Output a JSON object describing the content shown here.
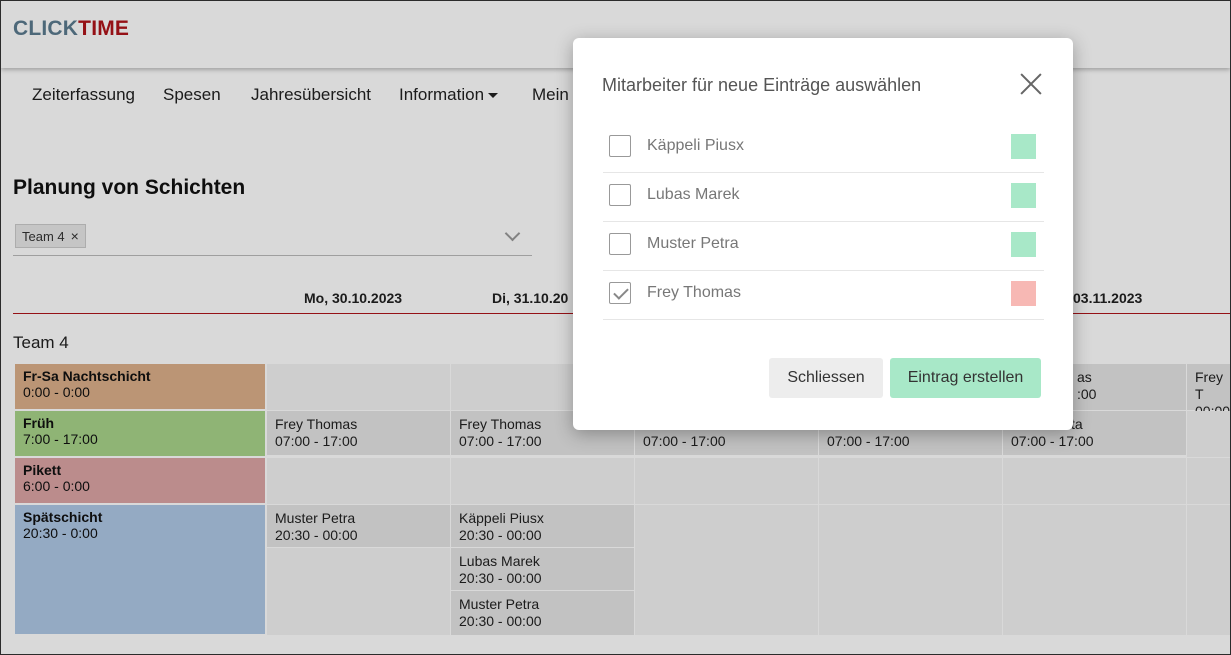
{
  "logo": {
    "part1": "CLICK",
    "part2": "TIME"
  },
  "nav": [
    {
      "label": "Zeiterfassung"
    },
    {
      "label": "Spesen"
    },
    {
      "label": "Jahresübersicht"
    },
    {
      "label": "Information"
    },
    {
      "label": "Mein T"
    }
  ],
  "page_title": "Planung von Schichten",
  "filter": {
    "chip": "Team 4",
    "chip_remove": "×"
  },
  "days": [
    "Mo, 30.10.2023",
    "Di, 31.10.20",
    "03.11.2023"
  ],
  "team_label": "Team 4",
  "shifts": [
    {
      "name": "Fr-Sa Nachtschicht",
      "time": "0:00 - 0:00",
      "color": "#dcb08a"
    },
    {
      "name": "Früh",
      "time": "7:00 - 17:00",
      "color": "#a8d48a"
    },
    {
      "name": "Pikett",
      "time": "6:00 - 0:00",
      "color": "#dca5a5"
    },
    {
      "name": "Spätschicht",
      "time": "20:30 - 0:00",
      "color": "#aec8e6"
    }
  ],
  "entries": {
    "frey": "Frey Thomas",
    "muster": "Muster Petra",
    "kappeli": "Käppeli Piusx",
    "lubas": "Lubas Marek",
    "t_frueh": "07:00 - 17:00",
    "t_spaet": "20:30 - 00:00",
    "partial_as": "as",
    "partial_00": ":00",
    "partial_frey_t": "Frey T",
    "partial_0000": "00:00",
    "partial_ta": "ta"
  },
  "modal": {
    "title": "Mitarbeiter für neue Einträge auswählen",
    "employees": [
      {
        "name": "Käppeli Piusx",
        "checked": false,
        "color": "#a8e8c8"
      },
      {
        "name": "Lubas Marek",
        "checked": false,
        "color": "#a8e8c8"
      },
      {
        "name": "Muster Petra",
        "checked": false,
        "color": "#a8e8c8"
      },
      {
        "name": "Frey Thomas",
        "checked": true,
        "color": "#f7b8b4"
      }
    ],
    "close_label": "Schliessen",
    "create_label": "Eintrag erstellen"
  }
}
